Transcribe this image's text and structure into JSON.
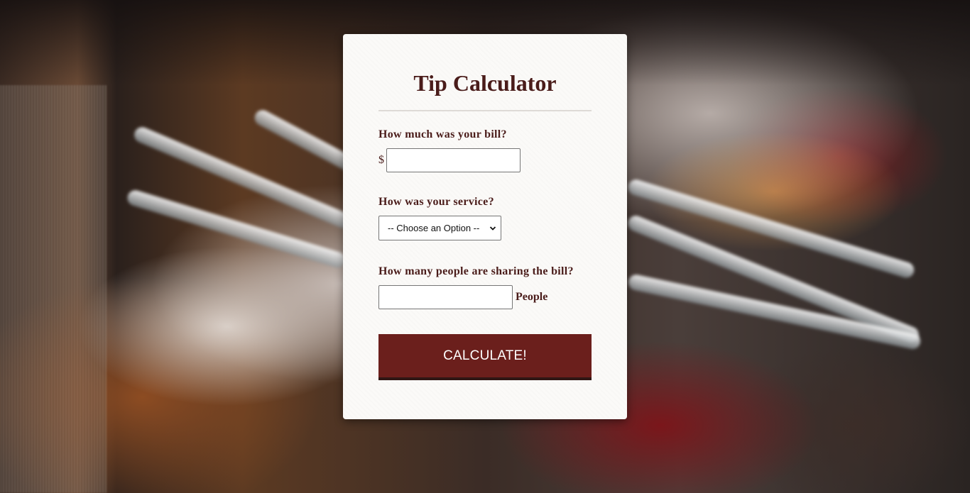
{
  "page": {
    "title": "Tip Calculator"
  },
  "bill": {
    "label": "How much was your bill?",
    "currency_symbol": "$",
    "value": ""
  },
  "service": {
    "label": "How was your service?",
    "selected_option": "-- Choose an Option --"
  },
  "people": {
    "label": "How many people are sharing the bill?",
    "value": "",
    "suffix": "People"
  },
  "actions": {
    "calculate_label": "CALCULATE!"
  },
  "colors": {
    "accent": "#6b1f1c",
    "heading_text": "#4a1c1a",
    "card_background": "#fbfaf8"
  }
}
